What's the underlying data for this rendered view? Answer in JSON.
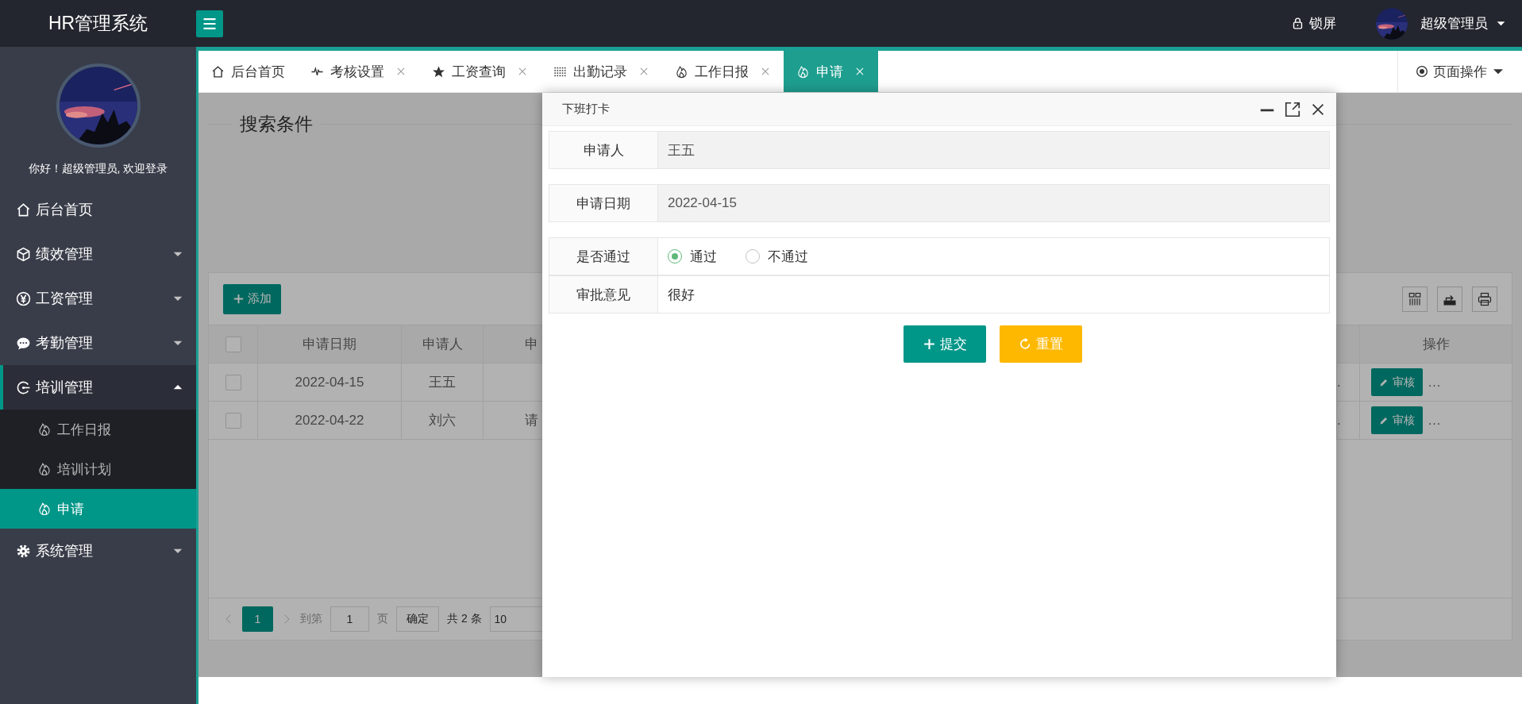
{
  "header": {
    "logo": "HR管理系统",
    "lock": "锁屏",
    "user": "超级管理员"
  },
  "sidebar": {
    "greeting": "你好！超级管理员, 欢迎登录",
    "items": [
      {
        "label": "后台首页"
      },
      {
        "label": "绩效管理",
        "expanded": false
      },
      {
        "label": "工资管理",
        "expanded": false
      },
      {
        "label": "考勤管理",
        "expanded": false
      },
      {
        "label": "培训管理",
        "expanded": true,
        "children": [
          {
            "label": "工作日报",
            "selected": false
          },
          {
            "label": "培训计划",
            "selected": false
          },
          {
            "label": "申请",
            "selected": true
          }
        ]
      },
      {
        "label": "系统管理",
        "expanded": false
      }
    ]
  },
  "tabs": [
    {
      "label": "后台首页",
      "closable": false,
      "selected": false
    },
    {
      "label": "考核设置",
      "closable": true,
      "selected": false
    },
    {
      "label": "工资查询",
      "closable": true,
      "selected": false
    },
    {
      "label": "出勤记录",
      "closable": true,
      "selected": false
    },
    {
      "label": "工作日报",
      "closable": true,
      "selected": false
    },
    {
      "label": "申请",
      "closable": true,
      "selected": true
    }
  ],
  "page_actions": "页面操作",
  "search_panel": {
    "title": "搜索条件"
  },
  "table": {
    "add_button": "添加",
    "select_all": {
      "checked": false
    },
    "columns": [
      "申请日期",
      "申请人",
      "申",
      "操作"
    ],
    "rows": [
      {
        "checked": false,
        "date": "2022-04-15",
        "applicant": "王五",
        "column_5": ".",
        "action": "审核",
        "more": "…"
      },
      {
        "checked": false,
        "date": "2022-04-22",
        "applicant": "刘六",
        "column_3": "请",
        "column_5": ".",
        "action": "审核",
        "more": "…"
      }
    ]
  },
  "pagination": {
    "pages": [
      {
        "label": "1",
        "selected": true
      }
    ],
    "goto_label": "到第",
    "goto_value": "1",
    "page_unit": "页",
    "confirm": "确定",
    "total": "共 2 条",
    "page_size": "10"
  },
  "dialog": {
    "title": "下班打卡",
    "fields": [
      {
        "kind": "readonly",
        "label": "申请人",
        "value": "王五"
      },
      {
        "kind": "readonly",
        "label": "申请日期",
        "value": "2022-04-15"
      },
      {
        "kind": "radio",
        "label": "是否通过",
        "options": [
          {
            "label": "通过",
            "selected": true
          },
          {
            "label": "不通过",
            "selected": false
          }
        ]
      },
      {
        "kind": "text",
        "label": "审批意见",
        "value": "很好"
      }
    ],
    "buttons": [
      {
        "kind": "submit",
        "label": "提交"
      },
      {
        "kind": "reset",
        "label": "重置"
      }
    ]
  }
}
